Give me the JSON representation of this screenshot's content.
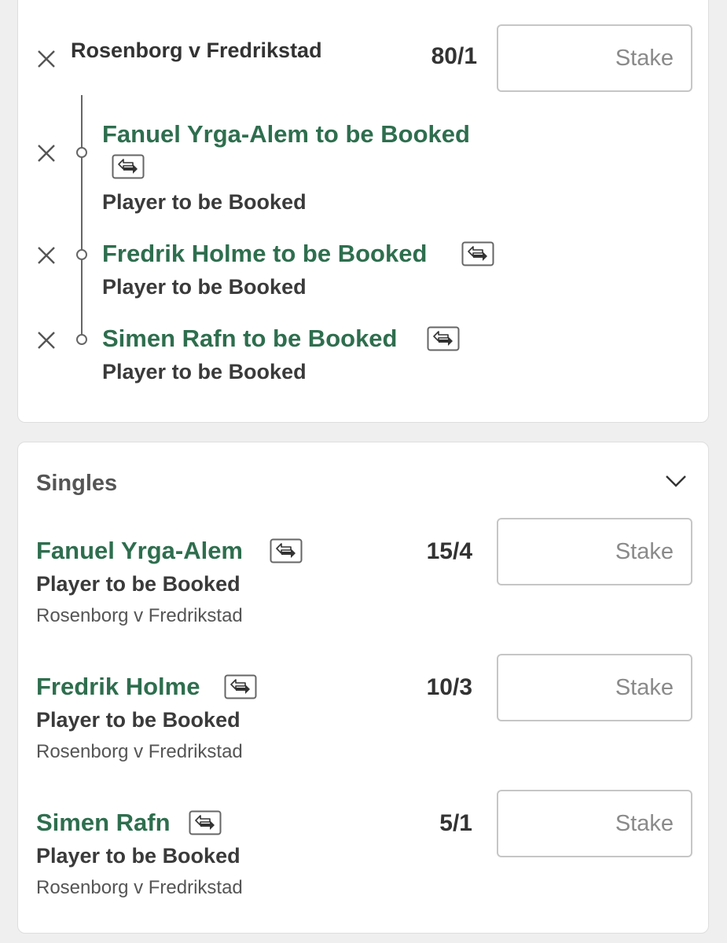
{
  "multiple": {
    "event": "Rosenborg v Fredrikstad",
    "odds": "80/1",
    "stake_placeholder": "Stake",
    "legs": [
      {
        "selection": "Fanuel Yrga-Alem to be Booked",
        "market": "Player to be Booked"
      },
      {
        "selection": "Fredrik Holme to be Booked",
        "market": "Player to be Booked"
      },
      {
        "selection": "Simen Rafn to be Booked",
        "market": "Player to be Booked"
      }
    ]
  },
  "singles": {
    "title": "Singles",
    "items": [
      {
        "selection": "Fanuel Yrga-Alem",
        "market": "Player to be Booked",
        "event": "Rosenborg v Fredrikstad",
        "odds": "15/4",
        "stake_placeholder": "Stake"
      },
      {
        "selection": "Fredrik Holme",
        "market": "Player to be Booked",
        "event": "Rosenborg v Fredrikstad",
        "odds": "10/3",
        "stake_placeholder": "Stake"
      },
      {
        "selection": "Simen Rafn",
        "market": "Player to be Booked",
        "event": "Rosenborg v Fredrikstad",
        "odds": "5/1",
        "stake_placeholder": "Stake"
      }
    ]
  },
  "icons": {
    "remove": "close-icon",
    "swap": "swap-icon",
    "expand": "chevron-down-icon"
  },
  "colors": {
    "selection_green": "#2e6e4e",
    "text_dark": "#333333",
    "background": "#efefef"
  }
}
